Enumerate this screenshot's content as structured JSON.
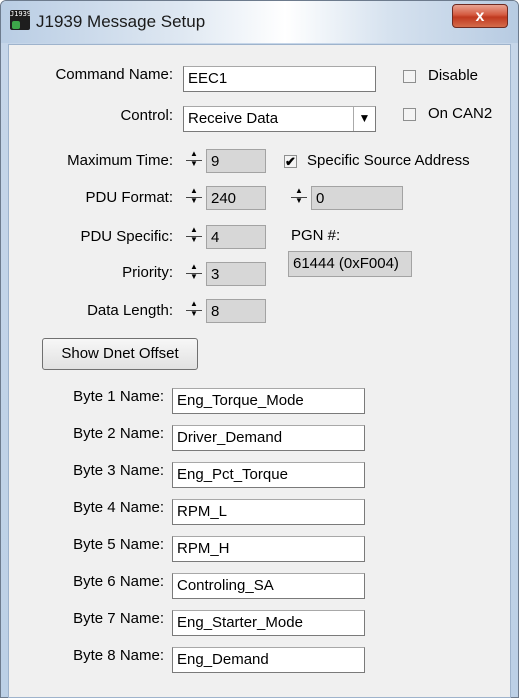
{
  "window": {
    "title": "J1939 Message Setup",
    "icon": "app-j1939-icon",
    "close_label": "x"
  },
  "header": {
    "command_name_label": "Command Name:",
    "command_name_value": "EEC1",
    "disable_label": "Disable",
    "disable_checked": false,
    "control_label": "Control:",
    "control_value": "Receive Data",
    "on_can2_label": "On CAN2",
    "on_can2_checked": false
  },
  "params": {
    "max_time_label": "Maximum Time:",
    "max_time_value": "9",
    "pdu_format_label": "PDU Format:",
    "pdu_format_value": "240",
    "pdu_specific_label": "PDU Specific:",
    "pdu_specific_value": "4",
    "priority_label": "Priority:",
    "priority_value": "3",
    "data_length_label": "Data Length:",
    "data_length_value": "8",
    "specific_source_label": "Specific Source Address",
    "specific_source_checked": true,
    "source_address_value": "0",
    "pgn_label": "PGN #:",
    "pgn_value": "61444 (0xF004)"
  },
  "show_dnet_label": "Show Dnet Offset",
  "bytes": [
    {
      "label": "Byte 1 Name:",
      "value": "Eng_Torque_Mode"
    },
    {
      "label": "Byte 2 Name:",
      "value": "Driver_Demand"
    },
    {
      "label": "Byte 3 Name:",
      "value": "Eng_Pct_Torque"
    },
    {
      "label": "Byte 4 Name:",
      "value": "RPM_L"
    },
    {
      "label": "Byte 5 Name:",
      "value": "RPM_H"
    },
    {
      "label": "Byte 6 Name:",
      "value": "Controling_SA"
    },
    {
      "label": "Byte 7 Name:",
      "value": "Eng_Starter_Mode"
    },
    {
      "label": "Byte 8 Name:",
      "value": "Eng_Demand"
    }
  ]
}
